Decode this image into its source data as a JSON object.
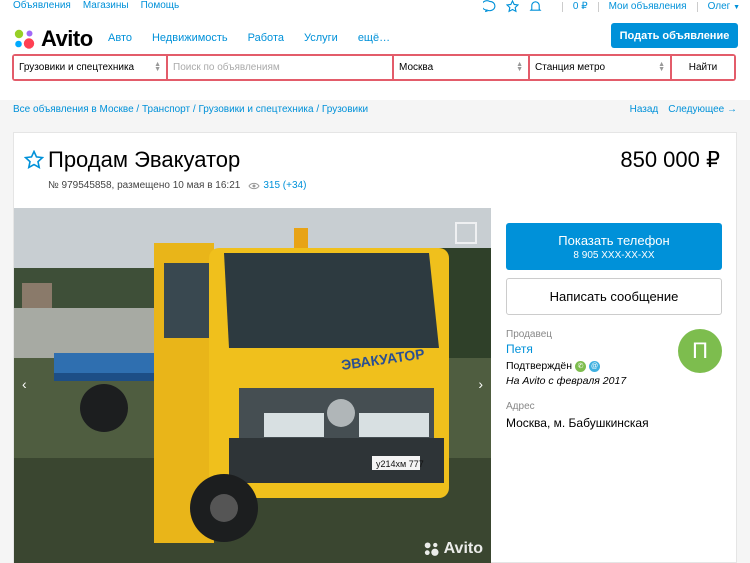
{
  "topbar": {
    "links": [
      "Объявления",
      "Магазины",
      "Помощь"
    ],
    "balance": "0 ₽",
    "my_ads": "Мои объявления",
    "user": "Олег"
  },
  "header": {
    "logo": "Avito",
    "nav": [
      "Авто",
      "Недвижимость",
      "Работа",
      "Услуги",
      "ещё…"
    ],
    "post_button": "Подать объявление"
  },
  "search": {
    "category": "Грузовики и спецтехника",
    "placeholder": "Поиск по объявлениям",
    "city": "Москва",
    "metro": "Станция метро",
    "submit": "Найти"
  },
  "breadcrumbs": [
    "Все объявления в Москве",
    "Транспорт",
    "Грузовики и спецтехника",
    "Грузовики"
  ],
  "pager": {
    "back": "Назад",
    "next": "Следующее →"
  },
  "listing": {
    "title": "Продам Эвакуатор",
    "price": "850 000 ₽",
    "meta": "№ 979545858, размещено 10 мая в 16:21",
    "views": "315 (+34)",
    "photo_watermark": "Avito",
    "truck_text": "ЭВАКУАТОР",
    "plate": "у214хм 777"
  },
  "contact": {
    "phone_button": "Показать телефон",
    "phone_masked": "8 905 XXX-XX-XX",
    "message_button": "Написать сообщение"
  },
  "seller": {
    "label": "Продавец",
    "name": "Петя",
    "confirmed": "Подтверждён",
    "since": "На Avito с февраля 2017",
    "avatar_letter": "П"
  },
  "address": {
    "label": "Адрес",
    "value": "Москва, м. Бабушкинская"
  },
  "colors": {
    "accent": "#0091d9",
    "search_border": "#e35c6a",
    "avatar": "#7dbd4e"
  }
}
